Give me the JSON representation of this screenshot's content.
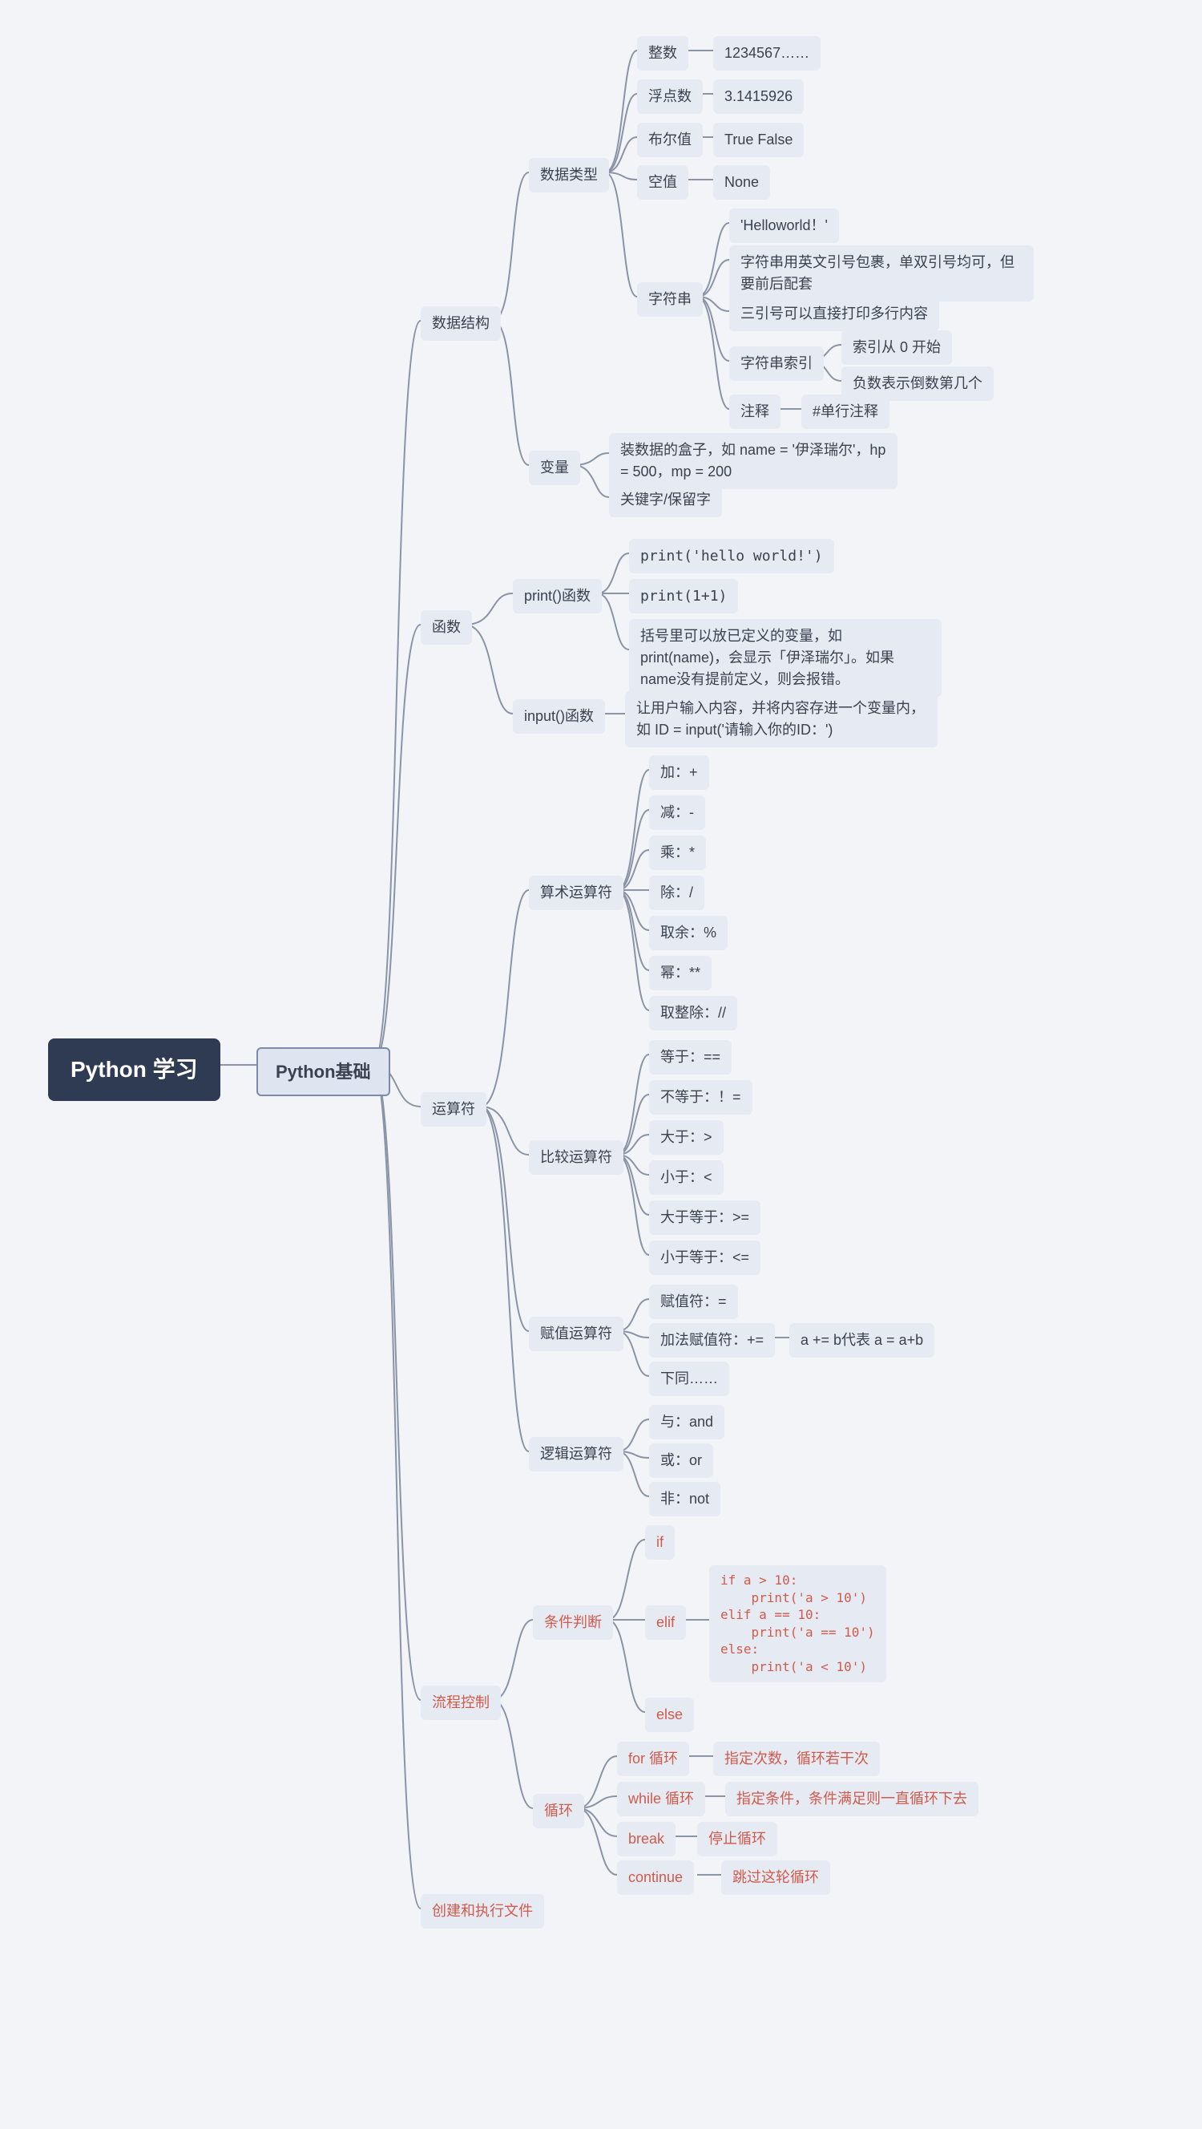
{
  "root": "Python 学习",
  "hub": "Python基础",
  "dataStruct": {
    "title": "数据结构",
    "dataType": {
      "title": "数据类型",
      "int": {
        "label": "整数",
        "ex": "1234567……"
      },
      "float": {
        "label": "浮点数",
        "ex": "3.1415926"
      },
      "bool": {
        "label": "布尔值",
        "ex": "True False"
      },
      "none": {
        "label": "空值",
        "ex": "None"
      },
      "str": {
        "label": "字符串",
        "hw": "'Helloworld！'",
        "quote": "字符串用英文引号包裹，单双引号均可，但要前后配套",
        "triple": "三引号可以直接打印多行内容",
        "index": {
          "label": "字符串索引",
          "zero": "索引从 0 开始",
          "neg": "负数表示倒数第几个"
        },
        "comment": {
          "label": "注释",
          "txt": "#单行注释"
        }
      }
    },
    "var": {
      "title": "变量",
      "box": "装数据的盒子，如 name = '伊泽瑞尔'，hp = 500，mp = 200",
      "kw": "关键字/保留字"
    }
  },
  "func": {
    "title": "函数",
    "print": {
      "label": "print()函数",
      "l1": "print('hello world!')",
      "l2": "print(1+1)",
      "l3": "括号里可以放已定义的变量，如print(name)，会显示「伊泽瑞尔」。如果name没有提前定义，则会报错。"
    },
    "input": {
      "label": "input()函数",
      "desc": "让用户输入内容，并将内容存进一个变量内，如 ID = input('请输入你的ID：')"
    }
  },
  "op": {
    "title": "运算符",
    "arith": {
      "label": "算术运算符",
      "add": "加：+",
      "sub": "减：-",
      "mul": "乘：*",
      "div": "除：/",
      "mod": "取余：%",
      "pow": "幂：**",
      "floor": "取整除：//"
    },
    "cmp": {
      "label": "比较运算符",
      "eq": "等于：==",
      "ne": "不等于：！=",
      "gt": "大于：>",
      "lt": "小于：<",
      "ge": "大于等于：>=",
      "le": "小于等于：<="
    },
    "assign": {
      "label": "赋值运算符",
      "eq": "赋值符：=",
      "add": "加法赋值符：+=",
      "addNote": "a += b代表 a = a+b",
      "etc": "下同……"
    },
    "logic": {
      "label": "逻辑运算符",
      "and": "与：and",
      "or": "或：or",
      "not": "非：not"
    }
  },
  "flow": {
    "title": "流程控制",
    "cond": {
      "label": "条件判断",
      "if": "if",
      "elif": "elif",
      "else": "else",
      "code": "if a > 10:\n    print('a > 10')\nelif a == 10:\n    print('a == 10')\nelse:\n    print('a < 10')"
    },
    "loop": {
      "label": "循环",
      "for": {
        "label": "for 循环",
        "desc": "指定次数，循环若干次"
      },
      "while": {
        "label": "while 循环",
        "desc": "指定条件，条件满足则一直循环下去"
      },
      "break": {
        "label": "break",
        "desc": "停止循环"
      },
      "continue": {
        "label": "continue",
        "desc": "跳过这轮循环"
      }
    }
  },
  "file": "创建和执行文件"
}
